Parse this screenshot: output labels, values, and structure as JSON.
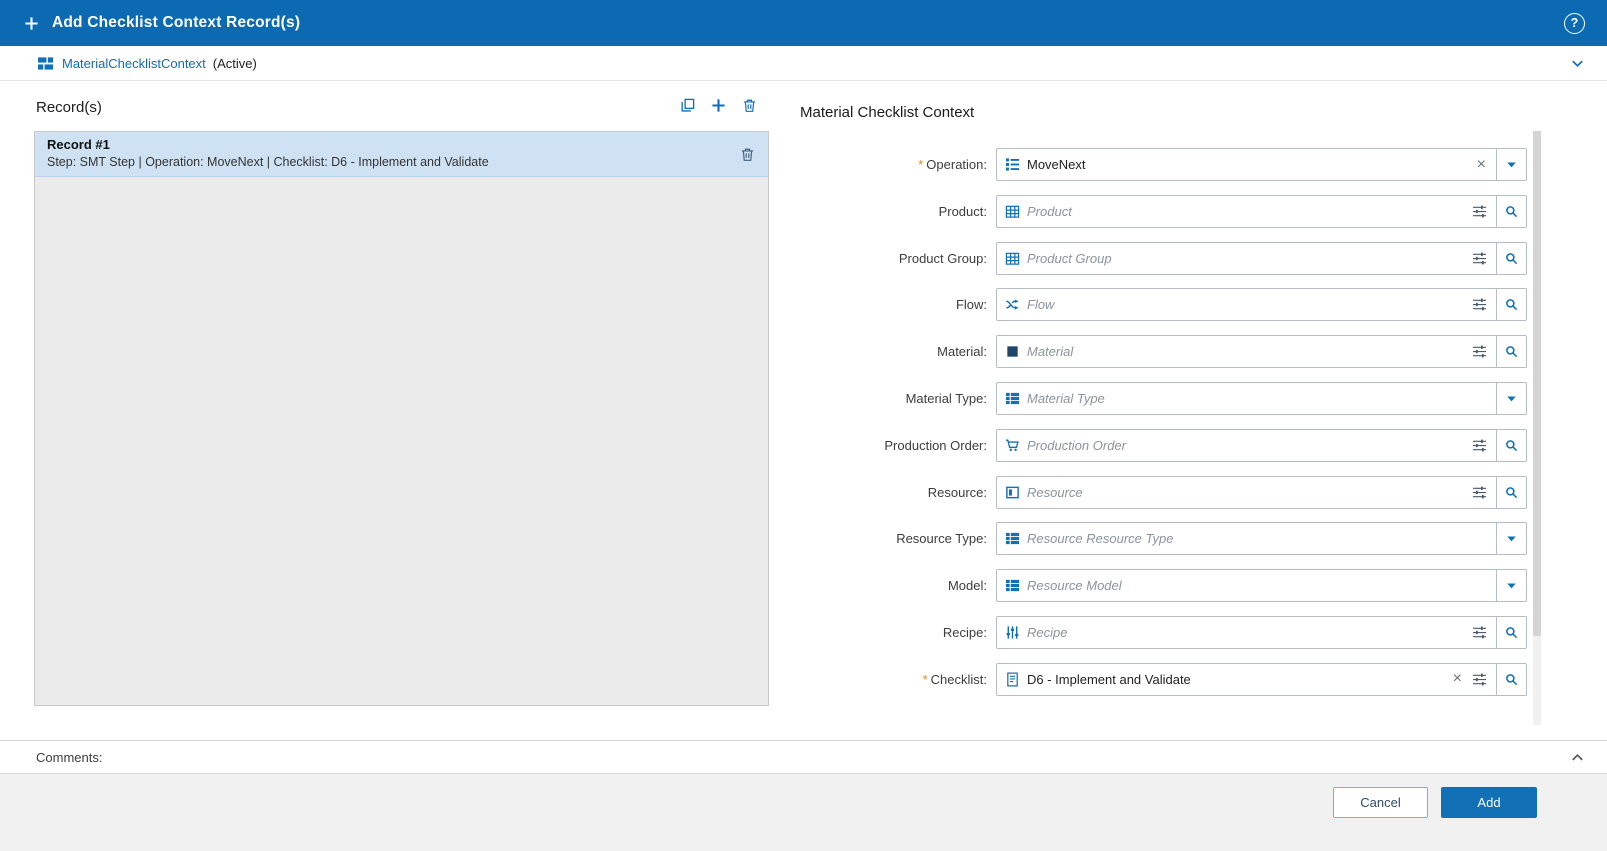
{
  "icons": {
    "help_glyph": "?",
    "clear_glyph": "×"
  },
  "titlebar": {
    "title": "Add Checklist Context Record(s)"
  },
  "context_bar": {
    "name": "MaterialChecklistContext",
    "status": "(Active)"
  },
  "records_panel": {
    "header": "Record(s)",
    "records": [
      {
        "title": "Record #1",
        "subtitle": "Step: SMT Step | Operation: MoveNext | Checklist: D6 - Implement and Validate"
      }
    ]
  },
  "form_panel": {
    "title": "Material Checklist Context",
    "required_marker": "*",
    "fields": [
      {
        "label": "Operation:",
        "required": true,
        "value": "MoveNext",
        "control": "dropdown-with-clear",
        "icon": "operation-icon"
      },
      {
        "label": "Product:",
        "required": false,
        "placeholder": "Product",
        "control": "search",
        "icon": "product-icon"
      },
      {
        "label": "Product Group:",
        "required": false,
        "placeholder": "Product Group",
        "control": "search",
        "icon": "product-group-icon"
      },
      {
        "label": "Flow:",
        "required": false,
        "placeholder": "Flow",
        "control": "search",
        "icon": "flow-icon"
      },
      {
        "label": "Material:",
        "required": false,
        "placeholder": "Material",
        "control": "search",
        "icon": "material-icon"
      },
      {
        "label": "Material Type:",
        "required": false,
        "placeholder": "Material Type",
        "control": "dropdown",
        "icon": "material-type-icon"
      },
      {
        "label": "Production Order:",
        "required": false,
        "placeholder": "Production Order",
        "control": "search",
        "icon": "production-order-icon"
      },
      {
        "label": "Resource:",
        "required": false,
        "placeholder": "Resource",
        "control": "search",
        "icon": "resource-icon"
      },
      {
        "label": "Resource Type:",
        "required": false,
        "placeholder": "Resource Resource Type",
        "control": "dropdown",
        "icon": "resource-type-icon"
      },
      {
        "label": "Model:",
        "required": false,
        "placeholder": "Resource Model",
        "control": "dropdown",
        "icon": "model-icon"
      },
      {
        "label": "Recipe:",
        "required": false,
        "placeholder": "Recipe",
        "control": "search",
        "icon": "recipe-icon"
      },
      {
        "label": "Checklist:",
        "required": true,
        "value": "D6 - Implement and Validate",
        "control": "search-with-clear",
        "icon": "checklist-icon"
      }
    ]
  },
  "comments": {
    "label": "Comments:"
  },
  "footer": {
    "cancel_label": "Cancel",
    "add_label": "Add"
  },
  "colors": {
    "brand_blue": "#0c6ab2",
    "accent_blue": "#0f6cbd",
    "selected_record_bg": "#cfe2f4",
    "required_orange": "#e0861a"
  }
}
